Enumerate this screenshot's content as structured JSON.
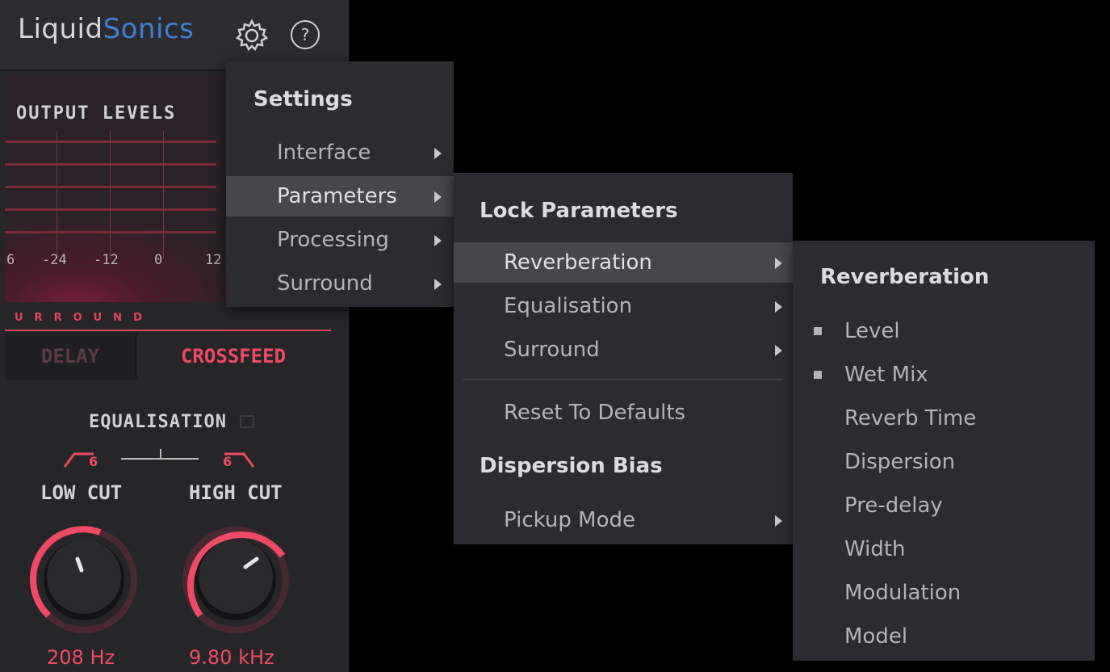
{
  "app": {
    "logo_part1": "Liquid",
    "logo_part2": "Sonics",
    "settings_icon": "gear-icon",
    "help_glyph": "?",
    "help_icon": "help-icon"
  },
  "meter": {
    "title": "OUTPUT LEVELS",
    "scale": [
      "6",
      "-24",
      "-12",
      "0",
      "12"
    ]
  },
  "surround_label": "URROUND",
  "tabs": {
    "delay": "DELAY",
    "crossfeed": "CROSSFEED"
  },
  "equalisation": {
    "title": "EQUALISATION",
    "low_slope": "6",
    "high_slope": "6",
    "low_cut": {
      "label": "LOW CUT",
      "value": "208 Hz"
    },
    "high_cut": {
      "label": "HIGH CUT",
      "value": "9.80 kHz"
    }
  },
  "settings_menu": {
    "title": "Settings",
    "items": [
      "Interface",
      "Parameters",
      "Processing",
      "Surround"
    ]
  },
  "parameters_menu": {
    "title": "Lock Parameters",
    "items": [
      "Reverberation",
      "Equalisation",
      "Surround"
    ],
    "reset": "Reset To Defaults",
    "dispersion_title": "Dispersion Bias",
    "pickup": "Pickup Mode"
  },
  "reverb_menu": {
    "title": "Reverberation",
    "items": [
      "Level",
      "Wet Mix",
      "Reverb Time",
      "Dispersion",
      "Pre-delay",
      "Width",
      "Modulation",
      "Model"
    ]
  },
  "colors": {
    "accent": "#ee4a66",
    "brand_blue": "#3f7fd0",
    "menu_bg": "#2c2c30",
    "highlight": "#46464c"
  }
}
